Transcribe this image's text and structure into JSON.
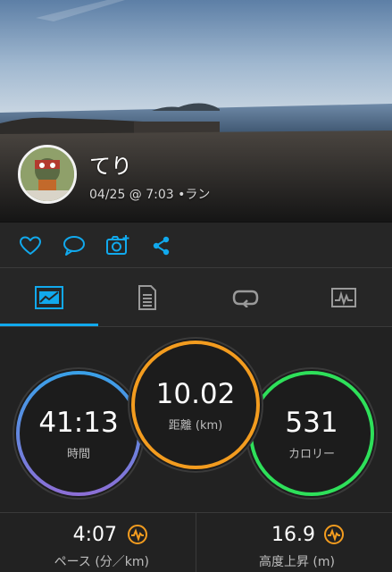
{
  "activity": {
    "user_name": "てり",
    "date_time": "04/25 @ 7:03",
    "separator": "•",
    "activity_type": "ラン"
  },
  "actions": {
    "like_icon": "heart-icon",
    "comment_icon": "speech-bubble-icon",
    "photo_icon": "add-photo-icon",
    "share_icon": "share-icon"
  },
  "tabs": [
    {
      "icon": "overview-stats-icon",
      "active": true
    },
    {
      "icon": "details-document-icon",
      "active": false
    },
    {
      "icon": "laps-loop-icon",
      "active": false
    },
    {
      "icon": "charts-icon",
      "active": false
    }
  ],
  "stats": {
    "time": {
      "value": "41:13",
      "label": "時間"
    },
    "distance": {
      "value": "10.02",
      "label": "距離 (km)"
    },
    "calories": {
      "value": "531",
      "label": "カロリー"
    }
  },
  "metrics": {
    "pace": {
      "value": "4:07",
      "label": "ペース (分／km)"
    },
    "elevation": {
      "value": "16.9",
      "label": "高度上昇 (m)"
    }
  },
  "colors": {
    "accent_blue": "#11a9ed",
    "time_ring_top": "#3aa0e8",
    "time_ring_bottom": "#8c6fd6",
    "distance_ring": "#f39c1f",
    "calories_ring": "#2ee05a",
    "badge_orange": "#f39c1f"
  }
}
